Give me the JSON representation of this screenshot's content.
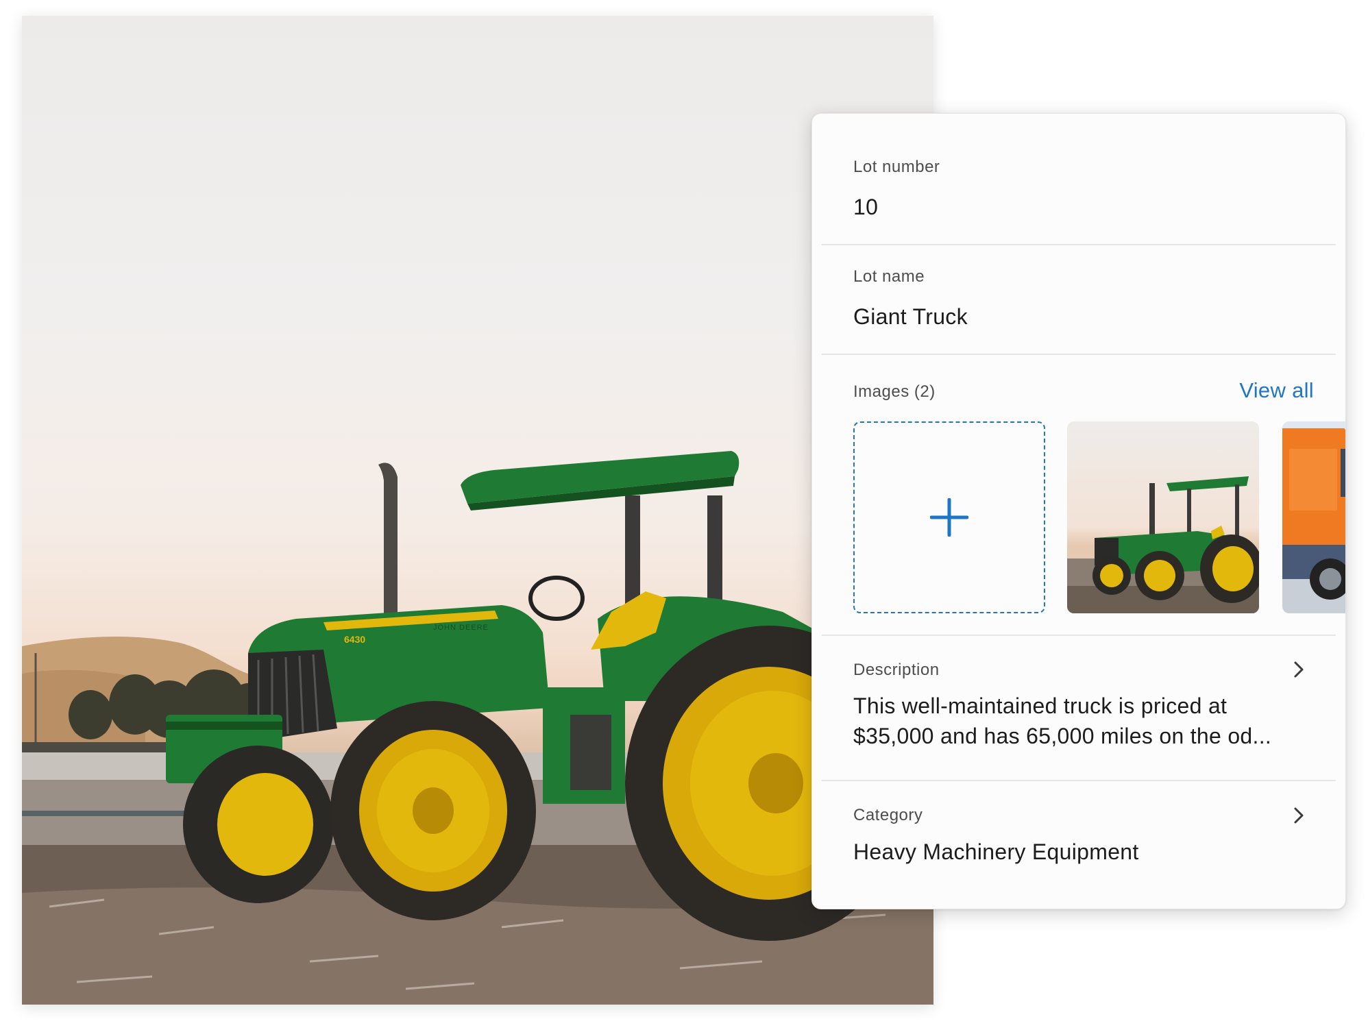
{
  "photo": {
    "icon": "tractor-photo",
    "badge_model": "6430",
    "badge_brand": "JOHN DEERE"
  },
  "form": {
    "lot_number": {
      "label": "Lot number",
      "value": "10"
    },
    "lot_name": {
      "label": "Lot name",
      "value": "Giant Truck"
    },
    "images": {
      "label": "Images (2)",
      "view_all": "View all",
      "add_icon": "plus-icon",
      "thumbs": [
        "tractor-thumbnail",
        "orange-truck-thumbnail"
      ]
    },
    "description": {
      "label": "Description",
      "value": "This well-maintained truck is priced at\n$35,000 and has 65,000 miles on the od..."
    },
    "category": {
      "label": "Category",
      "value": "Heavy Machinery Equipment"
    }
  },
  "colors": {
    "accent": "#1f76c2",
    "tractor_green": "#1f7a33",
    "wheel_yellow": "#e3b80c",
    "truck_orange": "#f07a22"
  }
}
